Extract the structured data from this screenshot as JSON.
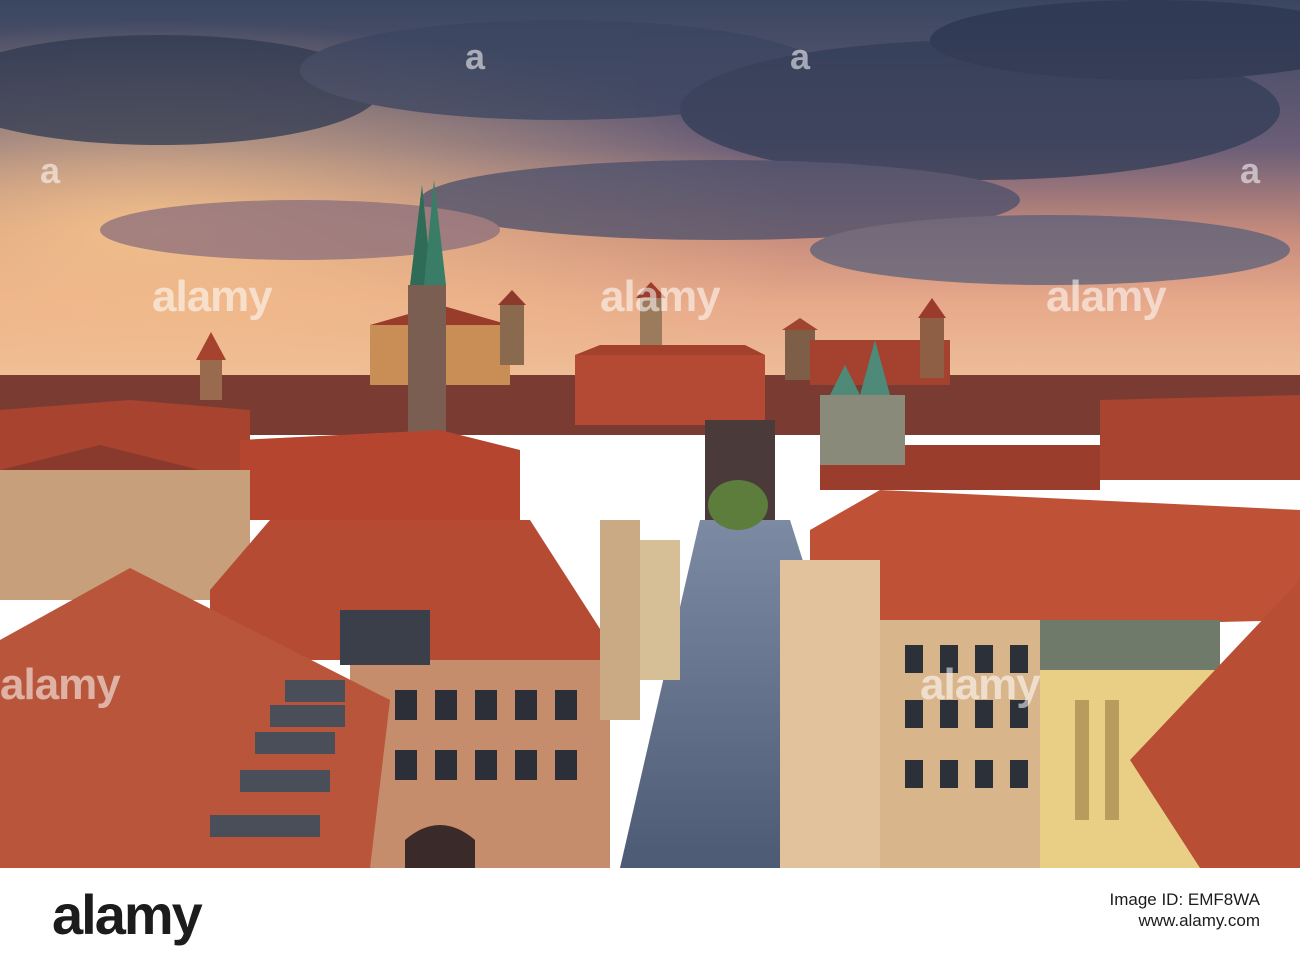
{
  "watermark": {
    "text": "alamy",
    "image": "a"
  },
  "footer": {
    "logo": "alamy",
    "caption": "Image ID: EMF8WA",
    "url": "www.alamy.com"
  },
  "colors": {
    "sky_top": "#3a4660",
    "sky_glow": "#e7a98a",
    "roof": "#b5452f",
    "wall": "#d9b58c",
    "street": "#5a6a86"
  }
}
